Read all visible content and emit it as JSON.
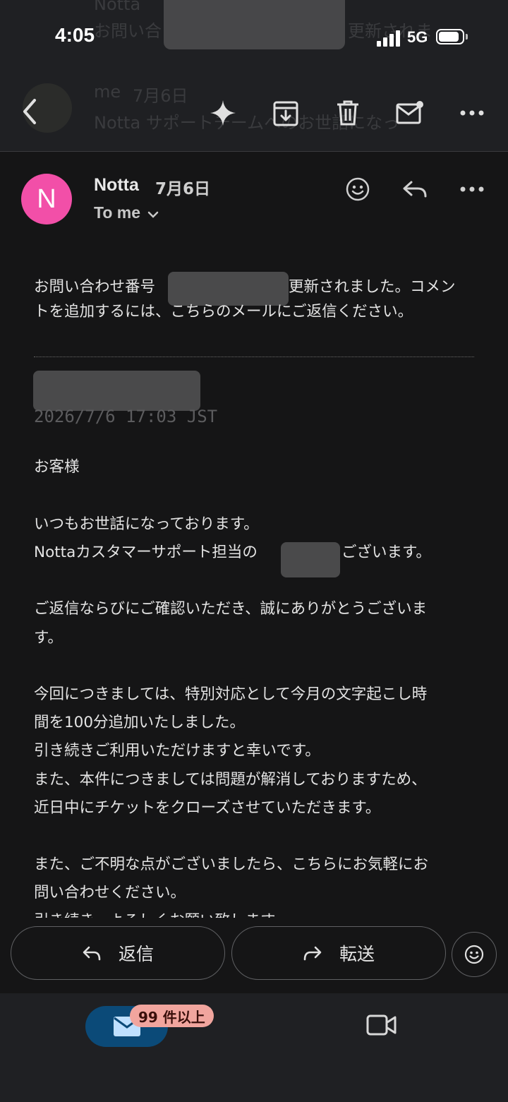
{
  "status_bar": {
    "time": "4:05",
    "network": "5G"
  },
  "background_preview": {
    "line1_prefix": "Notta",
    "line2_prefix": "お問い合",
    "line2_suffix": "更新されま",
    "row2_sender": "me",
    "row2_date": "7月6日",
    "row2_snippet": "Notta サポートチームへのお世話になっ"
  },
  "message": {
    "sender": "Notta",
    "avatar_letter": "N",
    "date": "7月6日",
    "recipient_label": "To me",
    "intro_line1_a": "お問い合わせ番号",
    "intro_line1_b": "更新されました。コメン",
    "intro_line2": "トを追加するには、こちらのメールにご返信ください。",
    "timestamp": "2026/7/6 17:03 JST",
    "salutation": "お客様",
    "para1_line1": "いつもお世話になっております。",
    "para1_line2_a": "Nottaカスタマーサポート担当の",
    "para1_line2_b": "ございます。",
    "para2_line1": "ご返信ならびにご確認いただき、誠にありがとうございま",
    "para2_line2": "す。",
    "para3_line1": "今回につきましては、特別対応として今月の文字起こし時",
    "para3_line2": "間を100分追加いたしました。",
    "para3_line3": "引き続きご利用いただけますと幸いです。",
    "para3_line4": "また、本件につきましては問題が解消しておりますため、",
    "para3_line5": "近日中にチケットをクローズさせていただきます。",
    "para4_line1": "また、ご不明な点がございましたら、こちらにお気軽にお",
    "para4_line2": "問い合わせください。",
    "para5_line1_partial": "引き続き、よろしくお願い致します。"
  },
  "actions": {
    "reply_label": "返信",
    "forward_label": "転送"
  },
  "bottom_nav": {
    "mail_badge": "99 件以上"
  },
  "colors": {
    "avatar": "#f24fa8",
    "mail_tab": "#0b4a78",
    "badge": "#f1a59e"
  }
}
